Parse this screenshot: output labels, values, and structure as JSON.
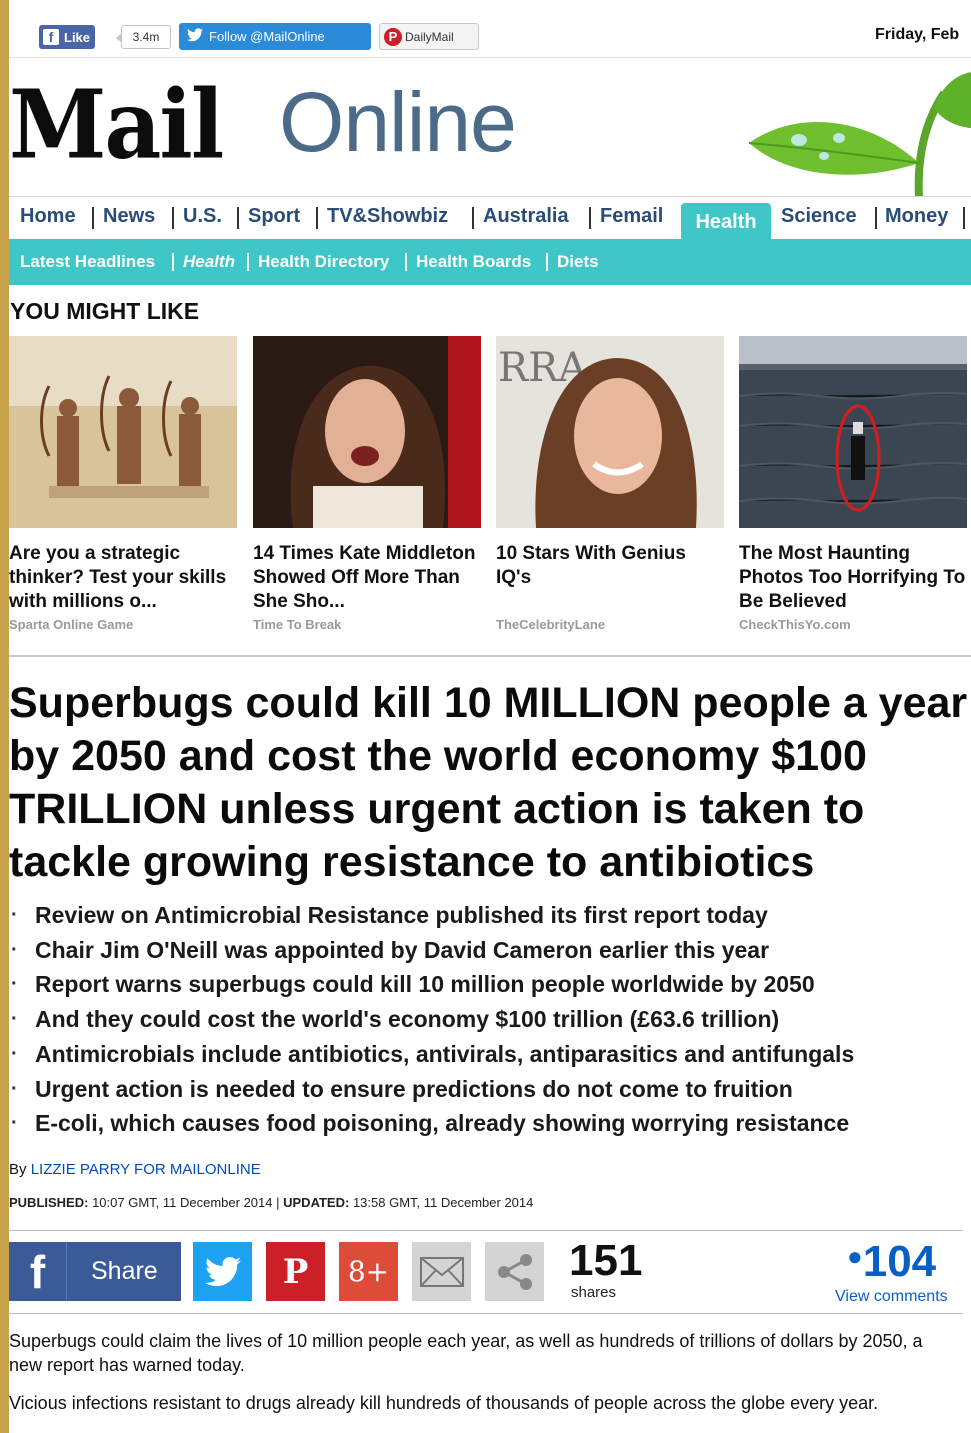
{
  "topbar": {
    "fb_like_label": "Like",
    "fb_like_count": "3.4m",
    "twitter_follow_label": "Follow @MailOnline",
    "pinterest_label": "DailyMail",
    "date_text": "Friday, Feb"
  },
  "masthead": {
    "logo_mail": "Mail",
    "logo_online": "Online"
  },
  "nav": {
    "items": [
      "Home",
      "News",
      "U.S.",
      "Sport",
      "TV&Showbiz",
      "Australia",
      "Femail",
      "Health",
      "Science",
      "Money"
    ],
    "active": "Health"
  },
  "subnav": {
    "items": [
      "Latest Headlines",
      "Health",
      "Health Directory",
      "Health Boards",
      "Diets"
    ]
  },
  "might_like": {
    "title": "YOU MIGHT LIKE",
    "cards": [
      {
        "title": "Are you a strategic thinker? Test your skills with millions o...",
        "source": "Sparta Online Game"
      },
      {
        "title": "14 Times Kate Middleton Showed Off More Than She Sho...",
        "source": "Time To Break"
      },
      {
        "title": "10 Stars With Genius IQ's",
        "source": "TheCelebrityLane"
      },
      {
        "title": "The Most Haunting Photos Too Horrifying To Be Believed",
        "source": "CheckThisYo.com"
      }
    ]
  },
  "article": {
    "headline": "Superbugs could kill 10 MILLION people a year by 2050 and cost the world economy $100 TRILLION unless urgent action is taken to tackle growing resistance to antibiotics",
    "bullets": [
      "Review on Antimicrobial Resistance published its first report today",
      "Chair Jim O'Neill was appointed by David Cameron earlier this year",
      "Report warns superbugs could kill 10 million people worldwide by 2050",
      "And they could cost the world's economy $100 trillion (£63.6 trillion)",
      "Antimicrobials include antibiotics, antivirals, antiparasitics and antifungals",
      "Urgent action is needed to ensure predictions do not come to fruition",
      "E-coli, which causes food poisoning, already showing worrying resistance"
    ],
    "byline_prefix": "By",
    "byline_author": "LIZZIE PARRY FOR MAILONLINE",
    "published_label": "PUBLISHED:",
    "published_value": "10:07 GMT, 11 December 2014",
    "updated_label": "UPDATED:",
    "updated_value": "13:58 GMT, 11 December 2014",
    "paragraphs": [
      "Superbugs could claim the lives of 10 million people each year, as well as hundreds of trillions of dollars by 2050, a new report has warned today.",
      "Vicious infections resistant to drugs already kill hundreds of thousands of people across the globe every year."
    ]
  },
  "share": {
    "share_label": "Share",
    "share_count": "151",
    "shares_label": "shares",
    "comments_count": "104",
    "view_comments": "View comments"
  },
  "colors": {
    "teal": "#3fc7c7",
    "nav_text": "#2a4c77",
    "facebook": "#3b5a98",
    "twitter": "#1da1f2",
    "pinterest": "#cb2027",
    "googleplus": "#dd4b39",
    "link_blue": "#0a5fc4",
    "page_border": "#c8a34a"
  }
}
